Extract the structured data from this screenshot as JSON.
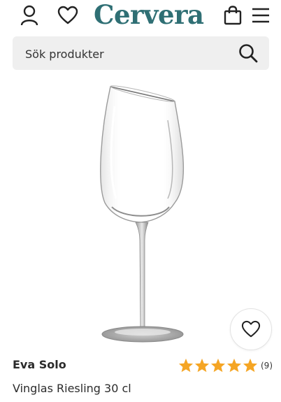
{
  "header": {
    "logo_text": "Cervera",
    "icons": [
      "user-icon",
      "heart-icon",
      "shopping-bag-icon",
      "menu-icon"
    ]
  },
  "search": {
    "placeholder": "Sök produkter",
    "icon": "search-icon"
  },
  "product": {
    "image": "wine-glass",
    "brand": "Eva Solo",
    "name": "Vinglas Riesling 30 cl",
    "rating": {
      "stars": 5,
      "max": 5,
      "count_label": "(9)"
    },
    "favorite_icon": "heart-icon"
  },
  "colors": {
    "logo": "#2f6f74",
    "star": "#f5a524",
    "search_bg": "#efefef"
  }
}
